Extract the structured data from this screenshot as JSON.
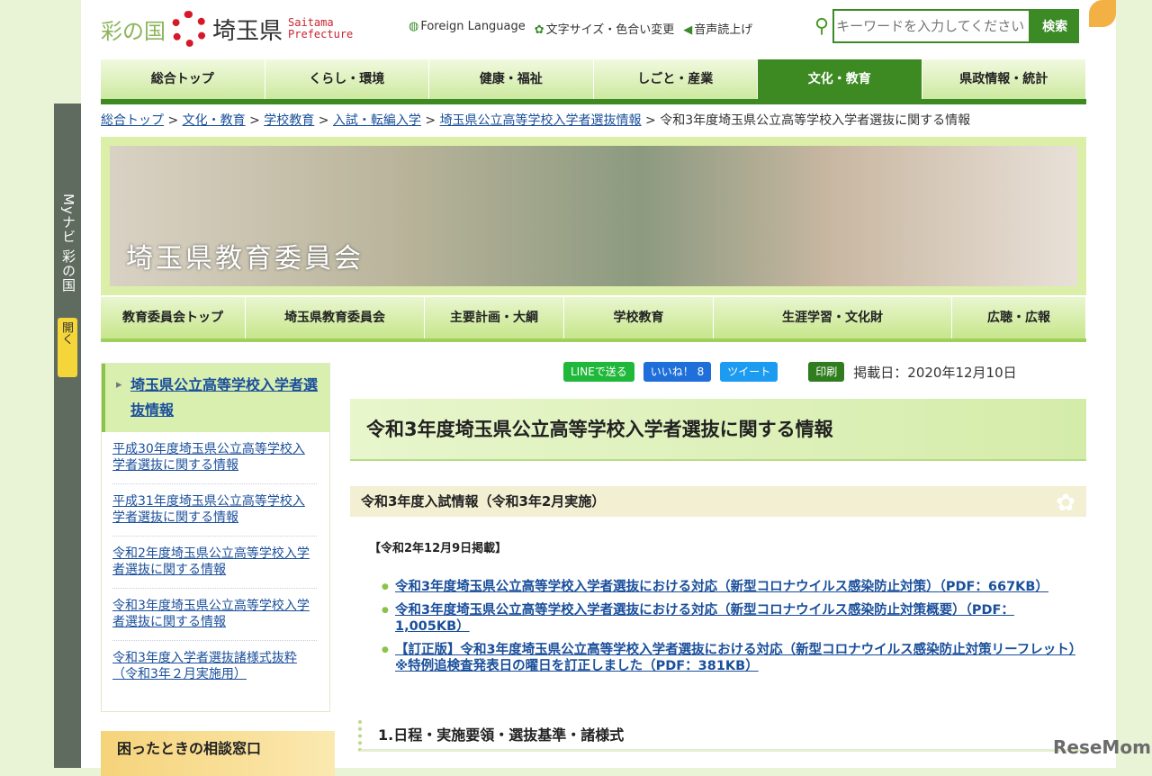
{
  "header": {
    "logo_prefix": "彩の国",
    "logo_main": "埼玉県",
    "logo_en1": "Saitama",
    "logo_en2": "Prefecture",
    "util": [
      "Foreign Language",
      "文字サイズ・色合い変更",
      "音声読上げ"
    ],
    "search_placeholder": "キーワードを入力してください",
    "search_button": "検索"
  },
  "global_nav": [
    "総合トップ",
    "くらし・環境",
    "健康・福祉",
    "しごと・産業",
    "文化・教育",
    "県政情報・統計"
  ],
  "breadcrumb": [
    "総合トップ",
    "文化・教育",
    "学校教育",
    "入試・転編入学",
    "埼玉県公立高等学校入学者選抜情報",
    "令和3年度埼玉県公立高等学校入学者選抜に関する情報"
  ],
  "banner_title": "埼玉県教育委員会",
  "sub_nav": [
    "教育委員会トップ",
    "埼玉県教育委員会",
    "主要計画・大綱",
    "学校教育",
    "生涯学習・文化財",
    "広聴・広報"
  ],
  "side_tab": {
    "label": "Myナビ 彩の国",
    "open": "開く"
  },
  "left_nav": {
    "current": "埼玉県公立高等学校入学者選抜情報",
    "items": [
      "平成30年度埼玉県公立高等学校入学者選抜に関する情報",
      "平成31年度埼玉県公立高等学校入学者選抜に関する情報",
      "令和2年度埼玉県公立高等学校入学者選抜に関する情報",
      "令和3年度埼玉県公立高等学校入学者選抜に関する情報",
      "令和3年度入学者選抜諸様式抜粋（令和3年２月実施用）"
    ]
  },
  "help_box": "困ったときの相談窓口",
  "share": {
    "line": "LINEで送る",
    "like": "いいね！ 8",
    "tweet": "ツイート",
    "print": "印刷",
    "date": "掲載日：2020年12月10日"
  },
  "main": {
    "title": "令和3年度埼玉県公立高等学校入学者選抜に関する情報",
    "section": "令和3年度入試情報（令和3年2月実施）",
    "posted": "【令和2年12月9日掲載】",
    "links": [
      "令和3年度埼玉県公立高等学校入学者選抜における対応（新型コロナウイルス感染防止対策）（PDF：667KB）",
      "令和3年度埼玉県公立高等学校入学者選抜における対応（新型コロナウイルス感染防止対策概要）（PDF：1,005KB）",
      "【訂正版】令和3年度埼玉県公立高等学校入学者選抜における対応（新型コロナウイルス感染防止対策リーフレット）※特例追検査発表日の曜日を訂正しました（PDF：381KB）"
    ],
    "subsection": "1.日程・実施要領・選抜基準・諸様式"
  },
  "watermark": "ReseMom"
}
